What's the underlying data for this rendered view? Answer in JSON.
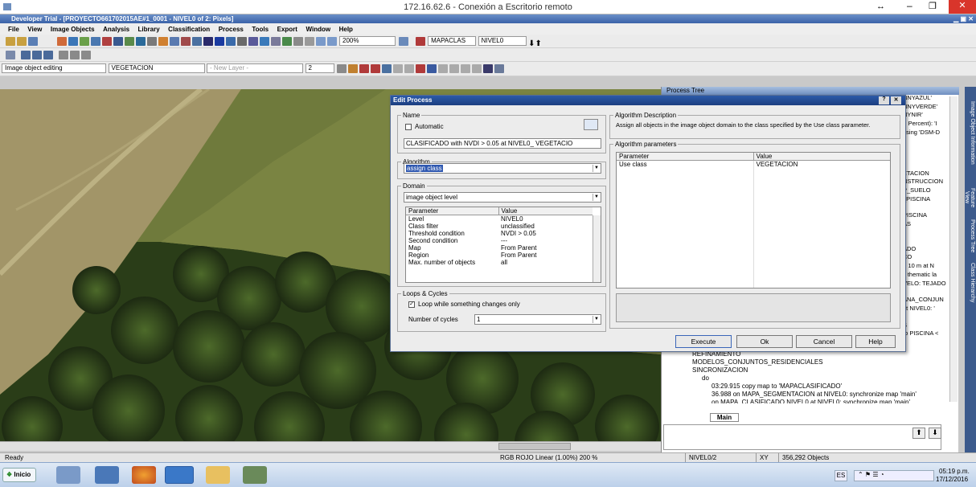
{
  "remote_title": "172.16.62.6 - Conexión a Escritorio remoto",
  "app_title": "Developer Trial - [PROYECTO661702015AE#1_0001 - NIVEL0 of 2: Pixels]",
  "menu": [
    "File",
    "View",
    "Image Objects",
    "Analysis",
    "Library",
    "Classification",
    "Process",
    "Tools",
    "Export",
    "Window",
    "Help"
  ],
  "toolbar1": {
    "zoom": "200%",
    "map": "MAPACLAS",
    "level": "NIVEL0"
  },
  "toolbar3": {
    "mode": "Image object editing",
    "class": "VEGETACION",
    "new_layer": "- New Layer -",
    "num": "2"
  },
  "process_tree": {
    "title": "Process Tree",
    "right_snippets": [
      "NNYAZUL'",
      "NNYVERDE'",
      "NYNIR'",
      "), Percent): 'I",
      "using 'DSM-D",
      "ETACION",
      "NSTRUCCION",
      "P_SUELO",
      "_PISCINA",
      "PISCINA",
      "AS",
      "ADO",
      "CO",
      "> 10 m at N",
      "y thematic la",
      "VELO: TEJADO",
      "ANA_CONJUN",
      "at NIVEL0: '",
      "S",
      "to PISCINA <"
    ],
    "items": [
      "REFINAMIENTO",
      "MODELOS_CONJUNTOS_RESIDENCIALES",
      "SINCRONIZACION",
      "do",
      "03:29.915  copy map to 'MAPACLASIFICADO'",
      "36.988  on MAPA_SEGMENTACION at  NIVEL0: synchronize map 'main'",
      "on MAPA_CLASIFICADO  NIVEL0 at  NIVEL0: synchronize map 'main'"
    ],
    "tab": "Main"
  },
  "side_tabs": [
    "Image Object Information",
    "Feature View",
    "Process Tree",
    "Class Hierarchy"
  ],
  "dialog": {
    "title": "Edit Process",
    "name_legend": "Name",
    "automatic": "Automatic",
    "name_value": "CLASIFICADO with NVDI > 0.05  at  NIVEL0_ VEGETACIO",
    "algorithm_legend": "Algorithm",
    "algorithm": "assign class",
    "domain_legend": "Domain",
    "domain": "image object level",
    "dom_header": [
      "Parameter",
      "Value"
    ],
    "dom_params": [
      [
        "Level",
        "NIVEL0"
      ],
      [
        "Class filter",
        "unclassified"
      ],
      [
        "Threshold condition",
        "NVDI > 0.05"
      ],
      [
        "Second condition",
        "---"
      ],
      [
        "Map",
        "From Parent"
      ],
      [
        "Region",
        "From Parent"
      ],
      [
        "Max. number of objects",
        "all"
      ]
    ],
    "loops_legend": "Loops & Cycles",
    "loop_text": "Loop while something changes only",
    "cycles_label": "Number of cycles",
    "cycles": "1",
    "desc_legend": "Algorithm Description",
    "desc": "Assign all objects in the image object domain to the class specified by the Use class parameter.",
    "params_legend": "Algorithm parameters",
    "param_header": [
      "Parameter",
      "Value"
    ],
    "params": [
      [
        "Use class",
        "VEGETACION"
      ]
    ],
    "buttons": {
      "execute": "Execute",
      "ok": "Ok",
      "cancel": "Cancel",
      "help": "Help"
    }
  },
  "status": {
    "ready": "Ready",
    "rgb": "RGB  ROJO  Linear (1.00%)  200 %",
    "level": "NIVEL0/2",
    "xy": "XY",
    "objects": "356,292 Objects"
  },
  "taskbar": {
    "start": "Inicio",
    "lang": "ES",
    "time": "05:19 p.m.",
    "date": "17/12/2016"
  }
}
